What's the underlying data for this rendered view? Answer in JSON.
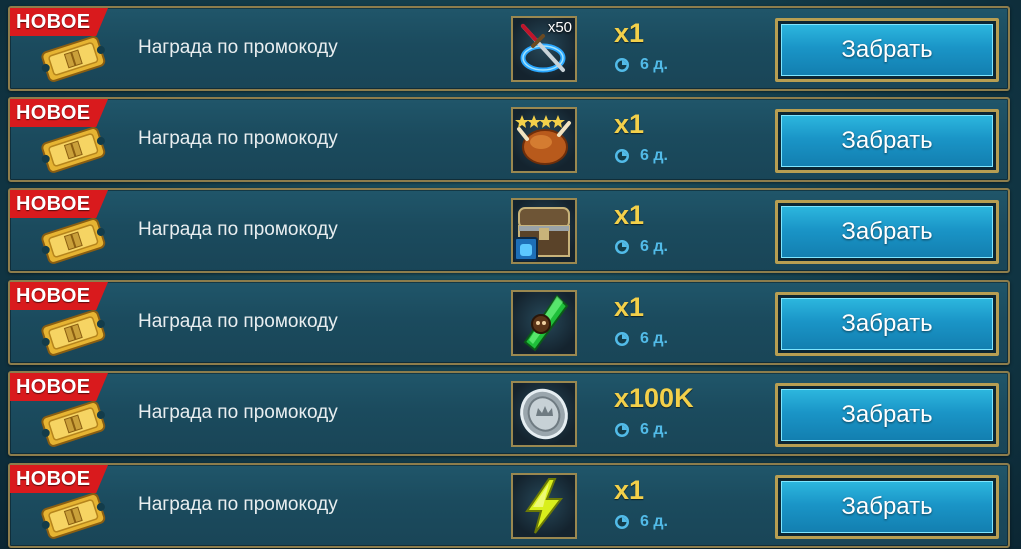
{
  "rows": [
    {
      "badge": "НОВОЕ",
      "label": "Награда по промокоду",
      "item_icon": "sword-portal-icon",
      "stack": "x50",
      "quantity": "x1",
      "time_left": "6 д.",
      "button_label": "Забрать"
    },
    {
      "badge": "НОВОЕ",
      "label": "Награда по промокоду",
      "item_icon": "roast-chicken-icon",
      "stack": "",
      "quantity": "x1",
      "time_left": "6 д.",
      "button_label": "Забрать"
    },
    {
      "badge": "НОВОЕ",
      "label": "Награда по промокоду",
      "item_icon": "treasure-chest-icon",
      "stack": "",
      "quantity": "x1",
      "time_left": "6 д.",
      "button_label": "Забрать"
    },
    {
      "badge": "НОВОЕ",
      "label": "Награда по промокоду",
      "item_icon": "green-shard-icon",
      "stack": "",
      "quantity": "x1",
      "time_left": "6 д.",
      "button_label": "Забрать"
    },
    {
      "badge": "НОВОЕ",
      "label": "Награда по промокоду",
      "item_icon": "silver-coin-icon",
      "stack": "",
      "quantity": "x100K",
      "time_left": "6 д.",
      "button_label": "Забрать"
    },
    {
      "badge": "НОВОЕ",
      "label": "Награда по промокоду",
      "item_icon": "lightning-bolt-icon",
      "stack": "",
      "quantity": "x1",
      "time_left": "6 д.",
      "button_label": "Забрать"
    }
  ],
  "colors": {
    "badge": "#d91a1d",
    "quantity": "#f3d04a",
    "timer": "#52bbe8",
    "button": "#1a95c7",
    "frame": "#8d7d4c"
  }
}
